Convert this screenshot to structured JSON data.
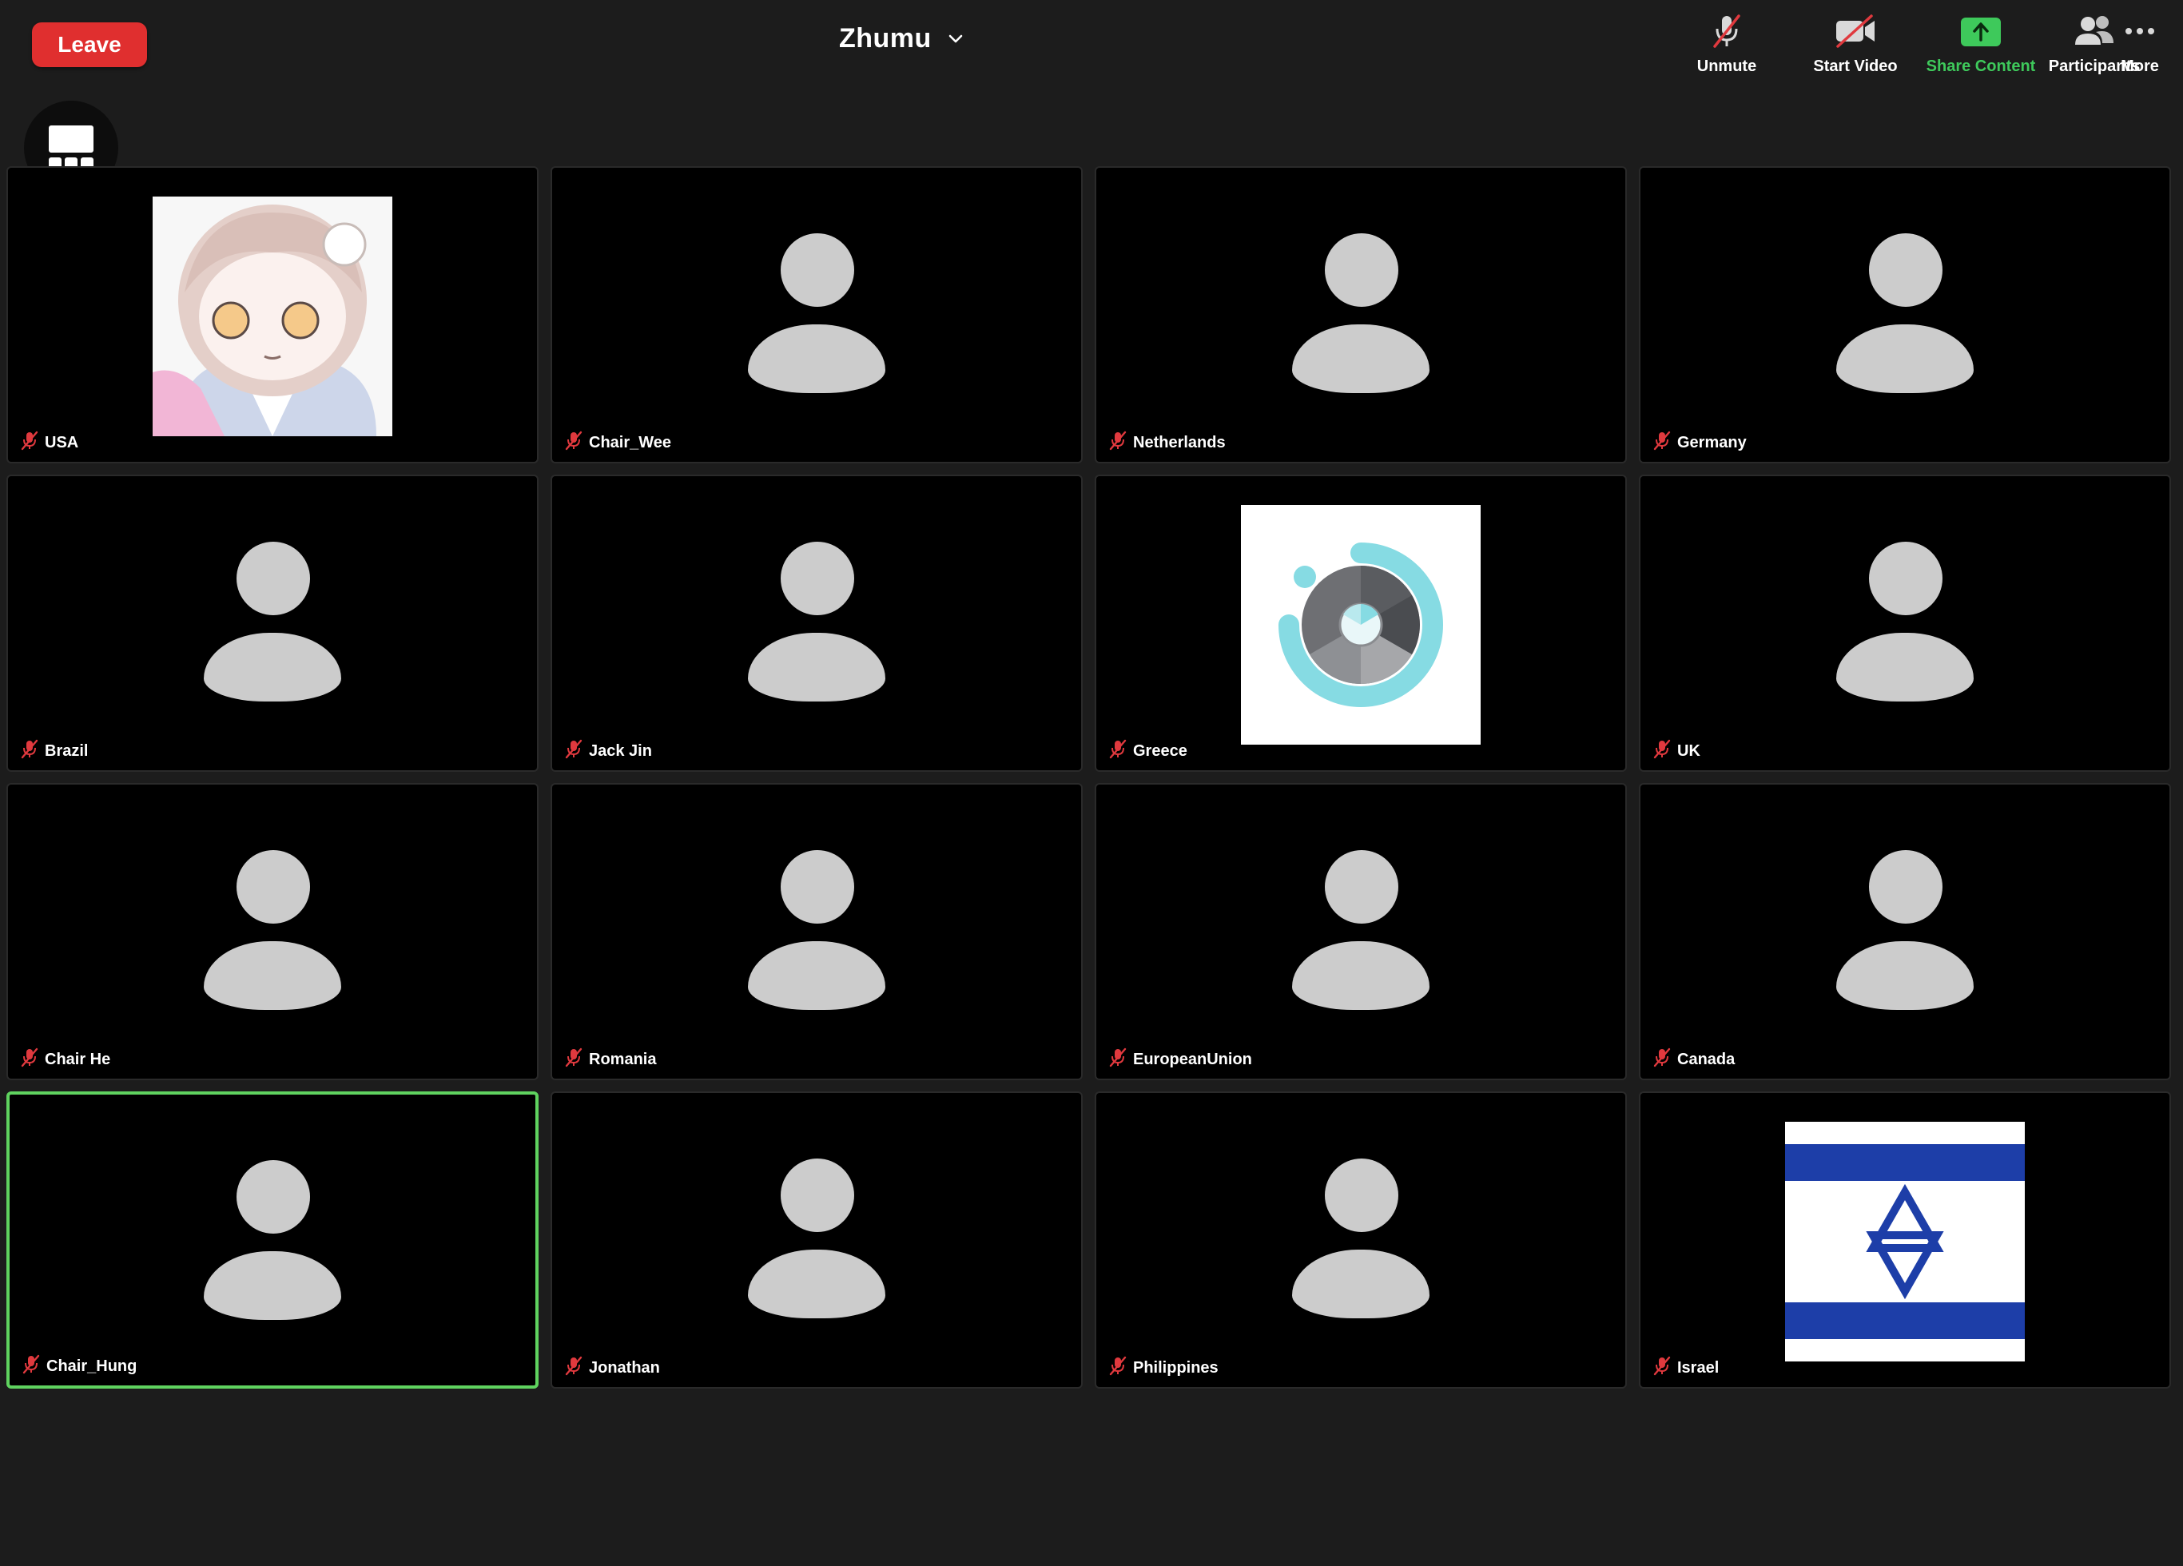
{
  "top_bar": {
    "leave_label": "Leave",
    "meeting_title": "Zhumu",
    "toolbar": [
      {
        "label": "Unmute",
        "icon": "muted-mic-icon"
      },
      {
        "label": "Start Video",
        "icon": "video-off-icon"
      },
      {
        "label": "Share Content",
        "icon": "share-content-icon",
        "color": "#3ec95b"
      },
      {
        "label": "Participants",
        "icon": "participants-icon"
      },
      {
        "label": "More",
        "icon": "more-dots-icon"
      }
    ]
  },
  "switch_speaker": {
    "label": "Switch to\nActive Speaker"
  },
  "colors": {
    "leave": "#e02f2f",
    "active_speaker_border": "#5fd35f",
    "muted_icon": "#e0393e",
    "avatar": "#cccccc",
    "share": "#3ec95b"
  },
  "participants": [
    {
      "name": "USA",
      "avatar": "anime-girl-picture",
      "muted": true
    },
    {
      "name": "Chair_Wee",
      "avatar": "default",
      "muted": true
    },
    {
      "name": "Netherlands",
      "avatar": "default",
      "muted": true
    },
    {
      "name": "Germany",
      "avatar": "default",
      "muted": true
    },
    {
      "name": "Brazil",
      "avatar": "default",
      "muted": true
    },
    {
      "name": "Jack Jin",
      "avatar": "default",
      "muted": true
    },
    {
      "name": "Greece",
      "avatar": "circular-logo-picture",
      "muted": true
    },
    {
      "name": "UK",
      "avatar": "default",
      "muted": true
    },
    {
      "name": "Chair He",
      "avatar": "default",
      "muted": true
    },
    {
      "name": "Romania",
      "avatar": "default",
      "muted": true
    },
    {
      "name": "EuropeanUnion",
      "avatar": "default",
      "muted": true
    },
    {
      "name": "Canada",
      "avatar": "default",
      "muted": true
    },
    {
      "name": "Chair_Hung",
      "avatar": "default",
      "muted": true,
      "active_speaker": true
    },
    {
      "name": "Jonathan",
      "avatar": "default",
      "muted": true
    },
    {
      "name": "Philippines",
      "avatar": "default",
      "muted": true
    },
    {
      "name": "Israel",
      "avatar": "israel-flag-picture",
      "muted": true
    }
  ]
}
